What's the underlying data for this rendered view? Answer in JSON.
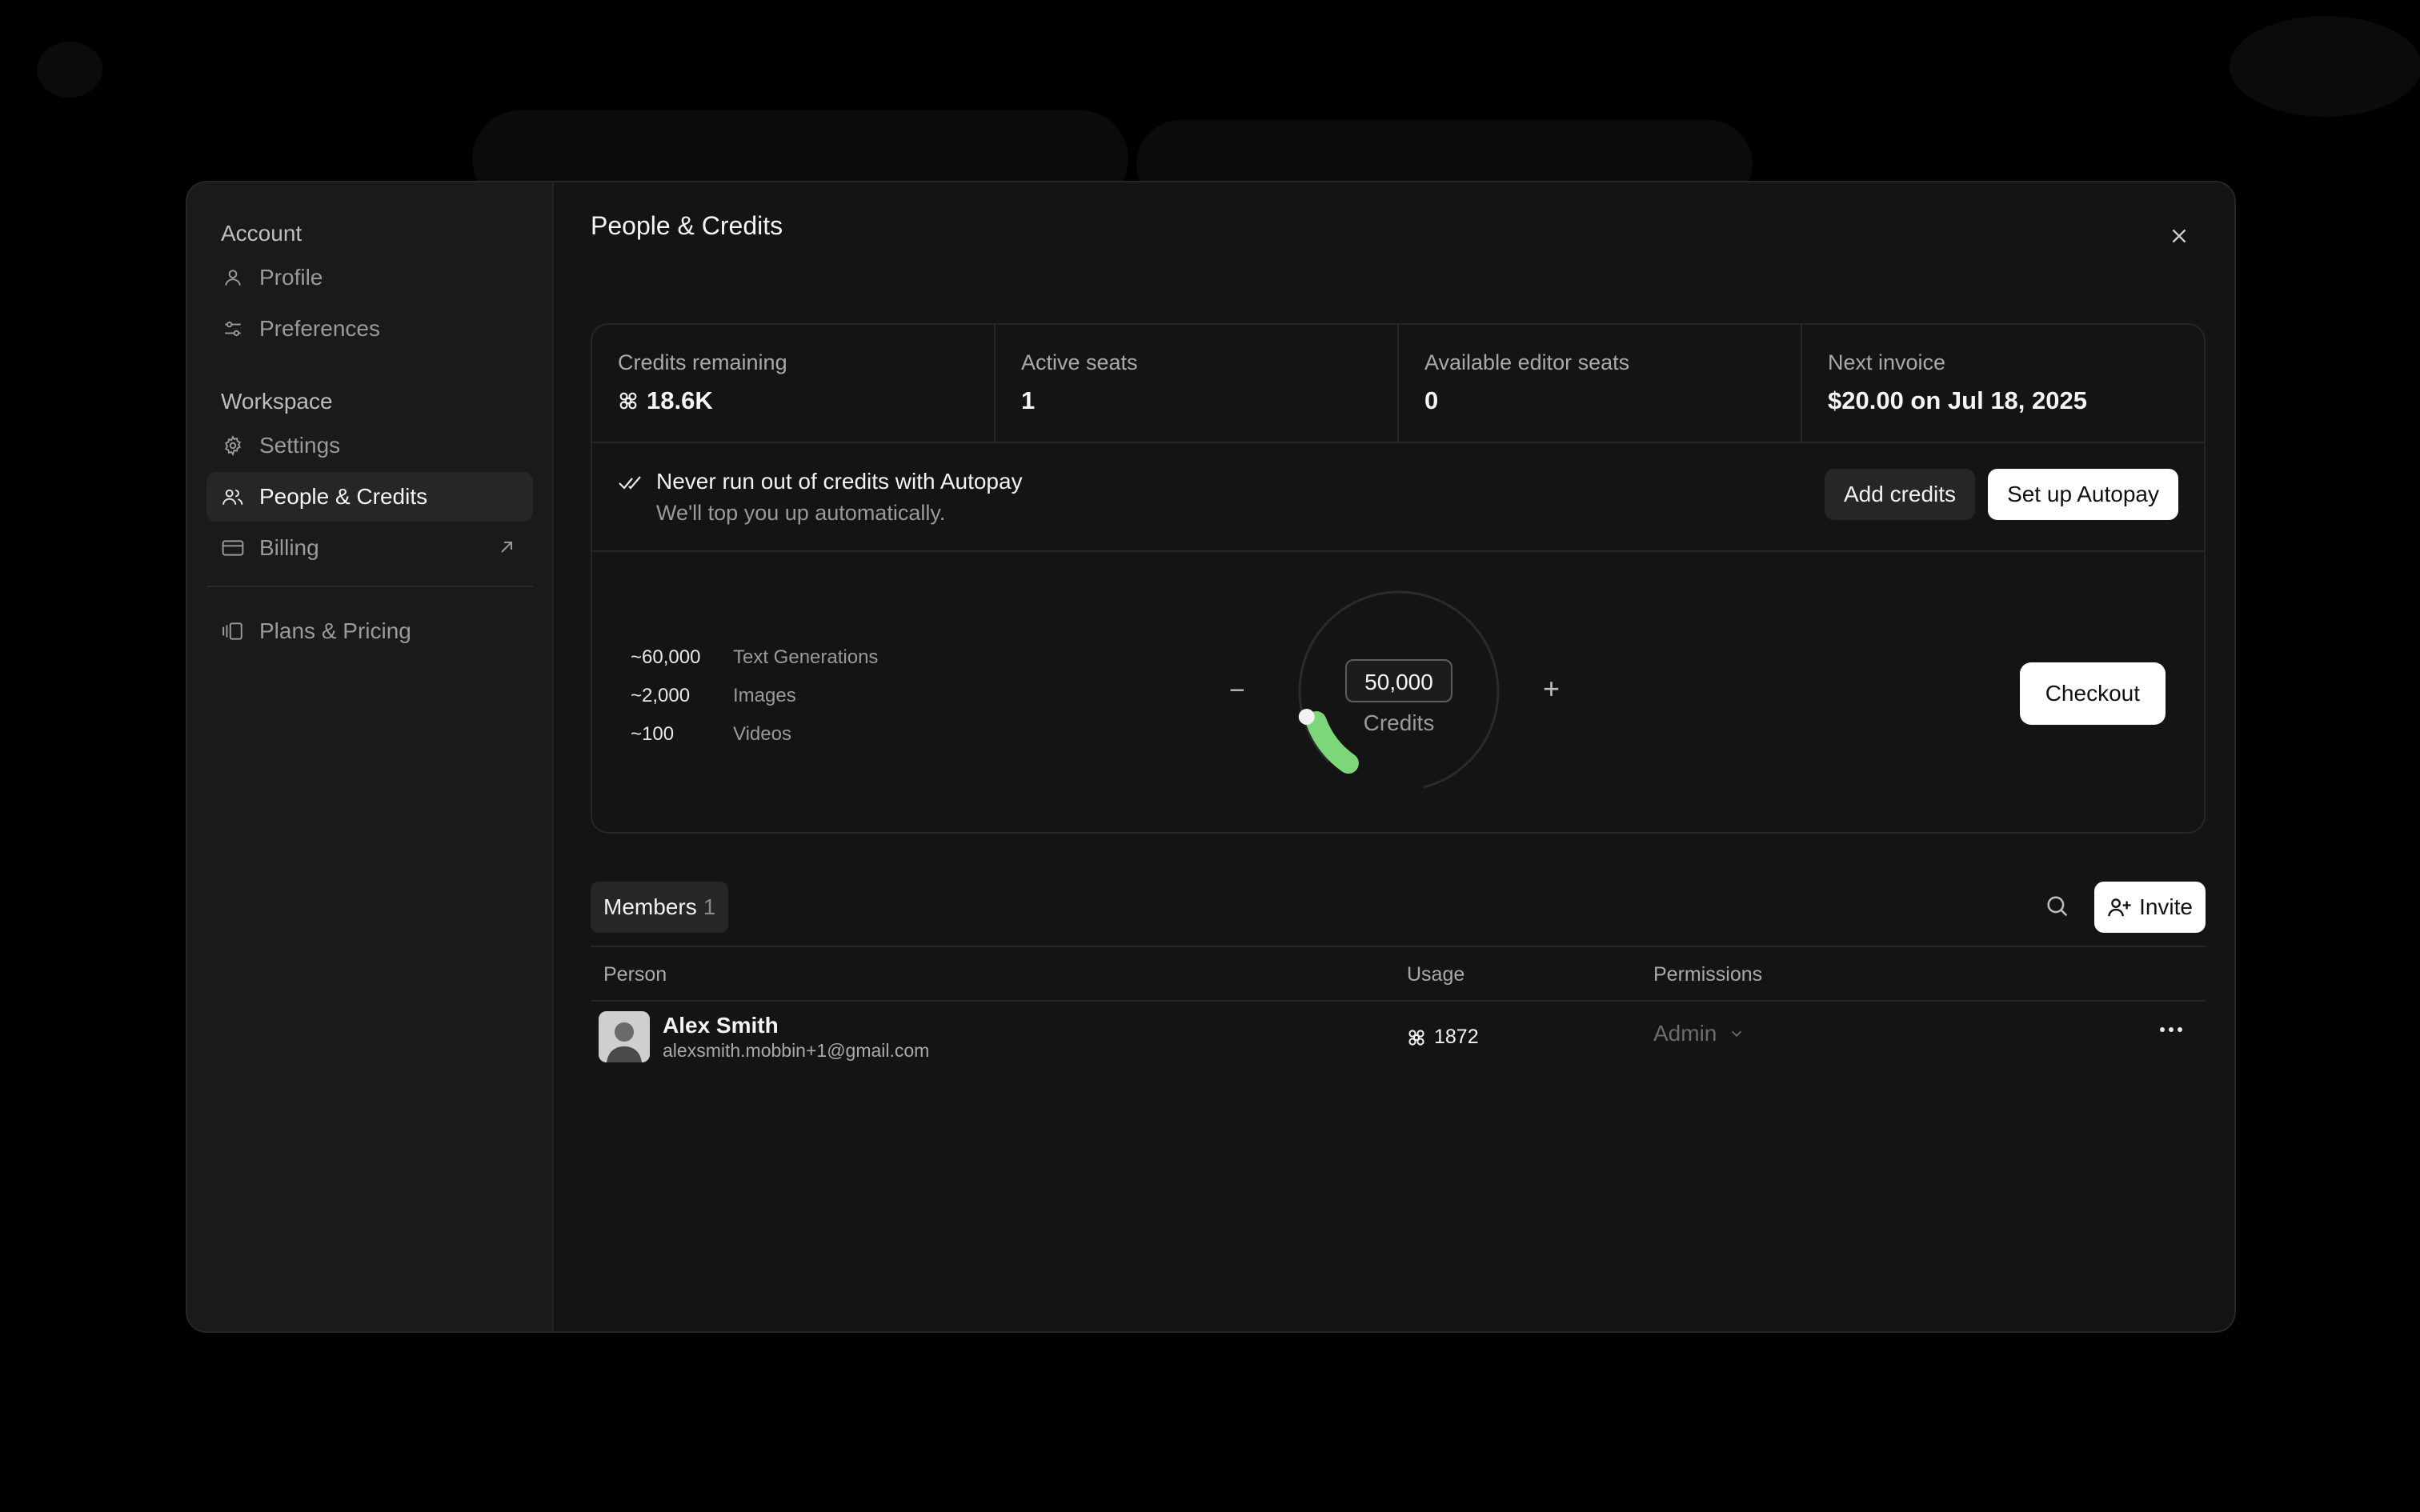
{
  "sidebar": {
    "account_title": "Account",
    "account_items": [
      {
        "label": "Profile",
        "icon": "user-icon"
      },
      {
        "label": "Preferences",
        "icon": "sliders-icon"
      }
    ],
    "workspace_title": "Workspace",
    "workspace_items": [
      {
        "label": "Settings",
        "icon": "gear-icon"
      },
      {
        "label": "People & Credits",
        "icon": "users-icon",
        "active": true
      },
      {
        "label": "Billing",
        "icon": "credit-card-icon",
        "external": true
      }
    ],
    "extra_items": [
      {
        "label": "Plans & Pricing",
        "icon": "plans-icon"
      }
    ]
  },
  "header": {
    "title": "People & Credits",
    "close_icon": "close-icon"
  },
  "stats": [
    {
      "label": "Credits remaining",
      "value": "18.6K",
      "icon": "credits-icon"
    },
    {
      "label": "Active seats",
      "value": "1"
    },
    {
      "label": "Available editor seats",
      "value": "0"
    },
    {
      "label": "Next invoice",
      "value": "$20.00 on Jul 18, 2025"
    }
  ],
  "autopay": {
    "title": "Never run out of credits with Autopay",
    "subtitle": "We'll top you up automatically.",
    "add_credits_label": "Add credits",
    "setup_label": "Set up Autopay"
  },
  "calculator": {
    "estimates": [
      {
        "amount": "~60,000",
        "label": "Text Generations"
      },
      {
        "amount": "~2,000",
        "label": "Images"
      },
      {
        "amount": "~100",
        "label": "Videos"
      }
    ],
    "minus_label": "−",
    "plus_label": "+",
    "credits_value": "50,000",
    "credits_unit": "Credits",
    "dial_fill": 0.12,
    "accent_color": "#7dd77a",
    "checkout_label": "Checkout"
  },
  "members": {
    "tab_label": "Members",
    "count": "1",
    "invite_label": "Invite",
    "columns": {
      "person": "Person",
      "usage": "Usage",
      "permissions": "Permissions"
    },
    "rows": [
      {
        "name": "Alex Smith",
        "email": "alexsmith.mobbin+1@gmail.com",
        "usage": "1872",
        "permission": "Admin"
      }
    ]
  }
}
